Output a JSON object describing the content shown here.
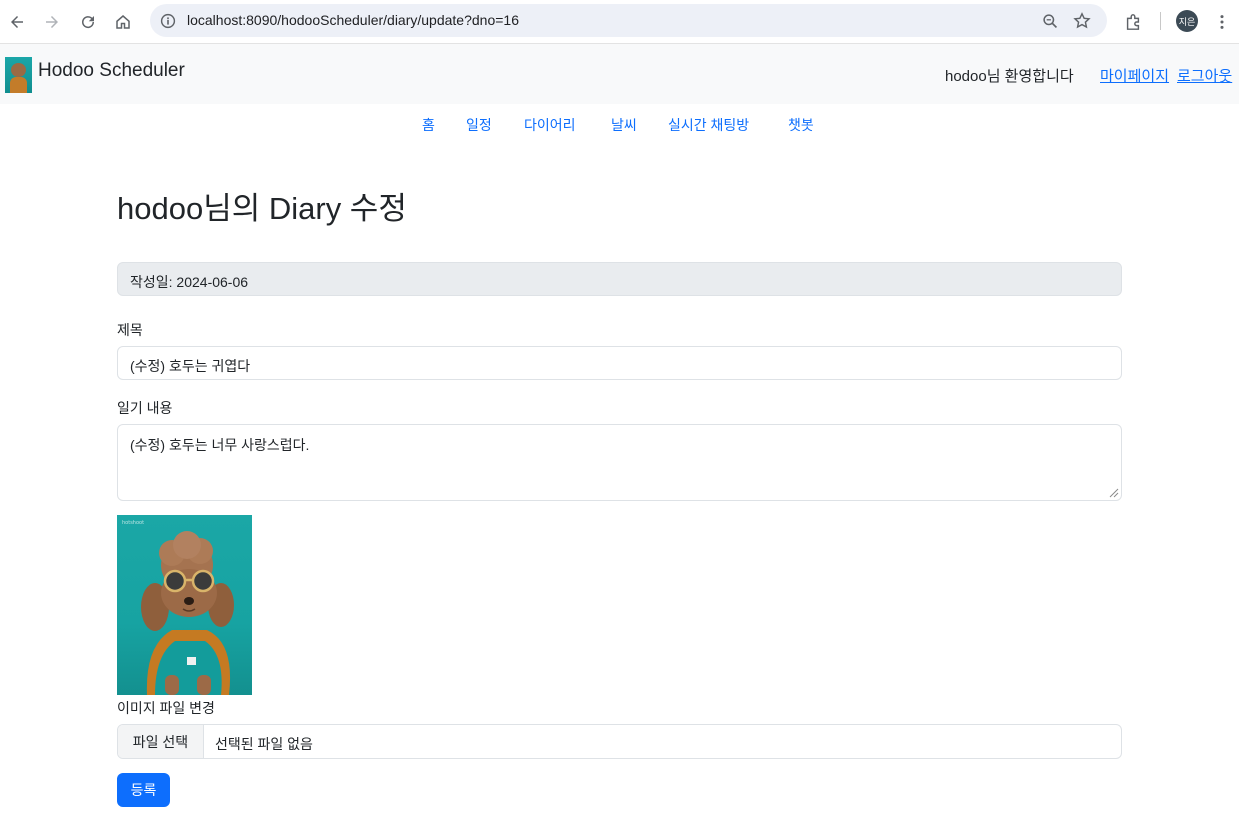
{
  "browser": {
    "url": "localhost:8090/hodooScheduler/diary/update?dno=16",
    "profile_initials": "지은"
  },
  "navbar": {
    "brand": "Hodoo Scheduler",
    "welcome": "hodoo님 환영합니다",
    "mypage": "마이페이지",
    "logout": "로그아웃"
  },
  "menu": {
    "items": [
      "홈",
      "일정",
      "다이어리",
      "날씨",
      "실시간 채팅방",
      "챗봇"
    ]
  },
  "page": {
    "title": "hodoo님의 Diary 수정",
    "date_label": "작성일: 2024-06-06",
    "title_label": "제목",
    "title_value": "(수정) 호두는 귀엽다",
    "content_label": "일기 내용",
    "content_value": "(수정) 호두는 너무 사랑스럽다.",
    "image_label": "이미지 파일 변경",
    "file_button": "파일 선택",
    "file_status": "선택된 파일 없음",
    "submit": "등록"
  },
  "colors": {
    "link": "#0d6efd",
    "primary_button": "#0d6efd",
    "navbar_bg": "#f8f9fa",
    "readonly_bg": "#e9ecef"
  },
  "icons": [
    "back-icon",
    "forward-icon",
    "reload-icon",
    "home-icon",
    "site-info-icon",
    "zoom-icon",
    "bookmark-star-icon",
    "extensions-icon",
    "more-menu-icon"
  ]
}
